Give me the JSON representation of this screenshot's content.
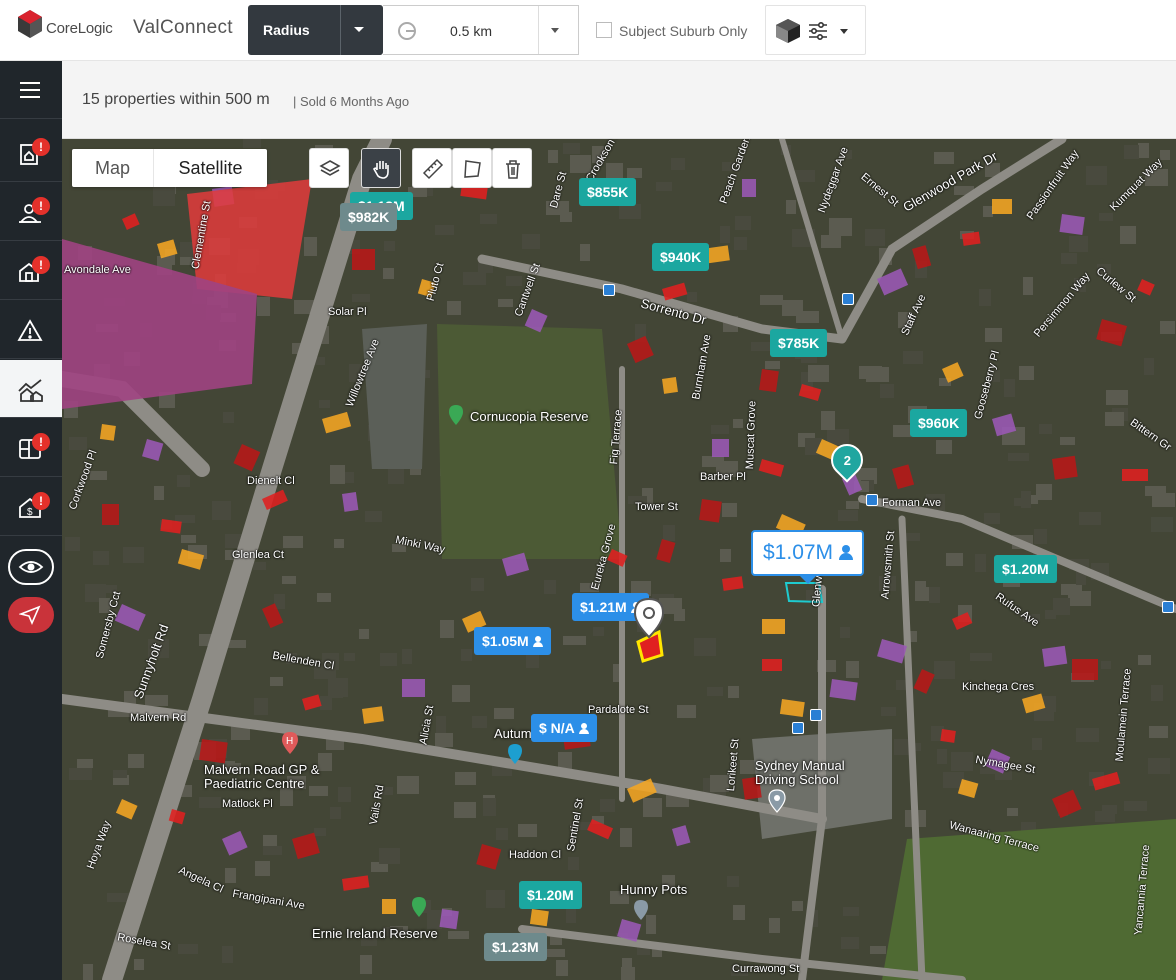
{
  "header": {
    "logo_text": "CoreLogic",
    "app_name": "ValConnect",
    "radius_label": "Radius",
    "distance_value": "0.5 km",
    "subject_suburb_only_label": "Subject Suburb Only",
    "subject_suburb_only_checked": false
  },
  "sidebar": {
    "items": [
      {
        "icon": "menu-icon",
        "badge": ""
      },
      {
        "icon": "property-report-icon",
        "badge": "!"
      },
      {
        "icon": "location-pin-person-icon",
        "badge": "!"
      },
      {
        "icon": "property-building-icon",
        "badge": "!"
      },
      {
        "icon": "warning-triangle-icon",
        "badge": ""
      },
      {
        "icon": "comparables-chart-icon",
        "badge": ""
      },
      {
        "icon": "floor-plan-icon",
        "badge": "!"
      },
      {
        "icon": "house-dollar-icon",
        "badge": "!"
      }
    ]
  },
  "summary": {
    "count_text": "15 properties within 500 m",
    "sold_text": "| Sold 6 Months Ago"
  },
  "map_controls": {
    "map_label": "Map",
    "satellite_label": "Satellite",
    "selected": "Satellite"
  },
  "prices": {
    "p1": "$1.13M",
    "p2": "$982K",
    "p3": "$855K",
    "p4": "$940K",
    "p5": "$785K",
    "p6": "$960K",
    "p7": "$1.21M",
    "p8": "$1.05M",
    "p9": "$ N/A",
    "p10": "$1.20M",
    "p11": "$1.20M",
    "p12": "$1.23M",
    "subject": "$1.07M",
    "cluster_count": "2"
  },
  "map_labels": {
    "streets": [
      "Avondale Ave",
      "Clementine St",
      "Sunnyholt Rd",
      "Solar Pl",
      "Pluto Ct",
      "Cantwell St",
      "Sorrento Dr",
      "Dare St",
      "Crookson Pl",
      "Peach Garden",
      "Nydeggar Ave",
      "Ernest St",
      "Glenwood Park Dr",
      "Passionfruit Way",
      "Kumquat Way",
      "Curlew St",
      "Persimmon Way",
      "Staff Ave",
      "Bittern Gr",
      "Gooseberry Pl",
      "Willowtree Ave",
      "Fig Terrace",
      "Burnham Ave",
      "Muscat Grove",
      "Barber Pl",
      "Tower St",
      "Forman Ave",
      "Arrowsmith St",
      "Dienelt Cl",
      "Corkwood Pl",
      "Glenlea Ct",
      "Minki Way",
      "Eureka Grove",
      "Bellenden Cl",
      "Somersby Cct",
      "Rufus Ave",
      "Kinchega Cres",
      "Malvern Rd",
      "Alicia St",
      "Pardalote St",
      "Vails Rd",
      "Matlock Pl",
      "Nymagee St",
      "Wanaaring Terrace",
      "Moulamein Terrace",
      "Lorikeet St",
      "Haddon Cl",
      "Sentinel St",
      "Angela Cl",
      "Frangipani Ave",
      "Hoya Way",
      "Roselea St",
      "Currawong St",
      "Yancannia Terrace",
      "Glenwood Dr"
    ],
    "pois": [
      "Cornucopia Reserve",
      "Malvern Road GP & Paediatric Centre",
      "Sydney Manual Driving School",
      "Hunny Pots",
      "Ernie Ireland Reserve",
      "Autumn"
    ]
  },
  "colors": {
    "sold_red": "#e02020",
    "sold_orange": "#f5a623",
    "sold_purple": "#9b59b6",
    "teal": "#1ba7a0",
    "blue": "#2c8fe8",
    "sidebar_bg": "#20262b"
  }
}
